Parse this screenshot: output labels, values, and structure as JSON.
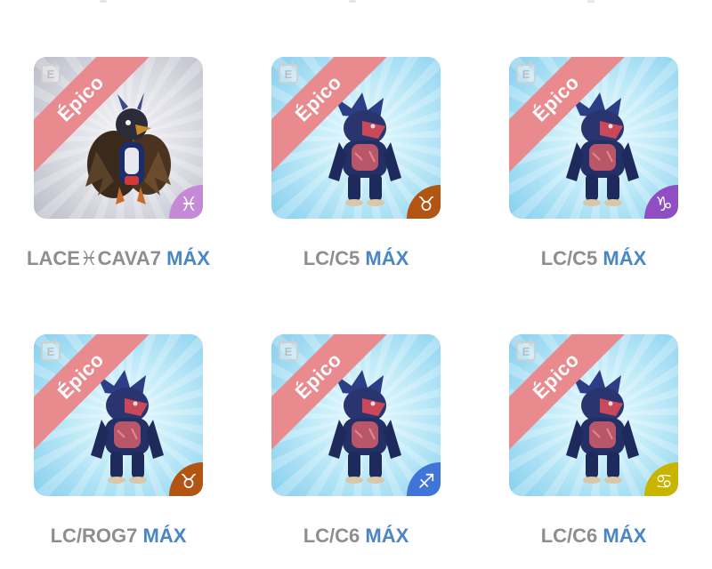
{
  "rarity_label": "Épico",
  "edition_icon_glyph": "E",
  "cards": [
    {
      "creature": "hawk",
      "bg": "gray",
      "zodiac": {
        "name": "pisces-icon",
        "glyph": "♓",
        "color": "#c58ad6"
      },
      "code": "LACE♓CAVA7",
      "max": "MÁX"
    },
    {
      "creature": "werewolf",
      "bg": "blue",
      "zodiac": {
        "name": "taurus-icon",
        "glyph": "♉",
        "color": "#b25412"
      },
      "code": "LC/C5",
      "max": "MÁX"
    },
    {
      "creature": "werewolf",
      "bg": "blue",
      "zodiac": {
        "name": "capricorn-icon",
        "glyph": "♑",
        "color": "#8f4ec4"
      },
      "code": "LC/C5",
      "max": "MÁX"
    },
    {
      "creature": "werewolf",
      "bg": "blue",
      "zodiac": {
        "name": "taurus-icon",
        "glyph": "♉",
        "color": "#b25412"
      },
      "code": "LC/ROG7",
      "max": "MÁX"
    },
    {
      "creature": "werewolf",
      "bg": "blue",
      "zodiac": {
        "name": "sagittarius-icon",
        "glyph": "♐",
        "color": "#3f75d8"
      },
      "code": "LC/C6",
      "max": "MÁX"
    },
    {
      "creature": "werewolf",
      "bg": "blue",
      "zodiac": {
        "name": "cancer-icon",
        "glyph": "♋",
        "color": "#c9b400"
      },
      "code": "LC/C6",
      "max": "MÁX"
    }
  ]
}
